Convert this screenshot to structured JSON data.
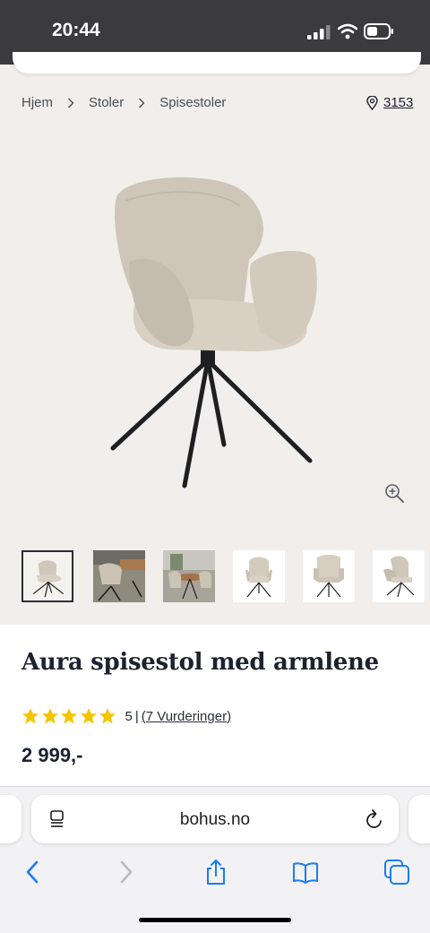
{
  "status": {
    "time": "20:44"
  },
  "breadcrumb": {
    "items": [
      "Hjem",
      "Stoler",
      "Spisestoler"
    ]
  },
  "store": {
    "number": "3153"
  },
  "product": {
    "title": "Aura spisestol med armlene",
    "rating": {
      "stars": 5,
      "value": "5",
      "separator": "|",
      "reviews_link": "(7 Vurderinger)"
    },
    "price": "2 999,-"
  },
  "browser": {
    "url": "bohus.no"
  },
  "icons": {
    "breadcrumb_separator": "chevron-right-icon",
    "store": "location-pin-icon",
    "zoom": "zoom-in-icon",
    "star": "star-icon",
    "reader": "reader-icon",
    "reload": "reload-icon",
    "back": "back-arrow-icon",
    "forward": "forward-arrow-icon",
    "share": "share-icon",
    "bookmarks": "bookmarks-icon",
    "tabs": "tabs-icon"
  },
  "colors": {
    "star": "#f4c400",
    "ios_blue": "#1a7cf5",
    "text": "#1d2230",
    "status_bar": "#3b3b3d"
  }
}
